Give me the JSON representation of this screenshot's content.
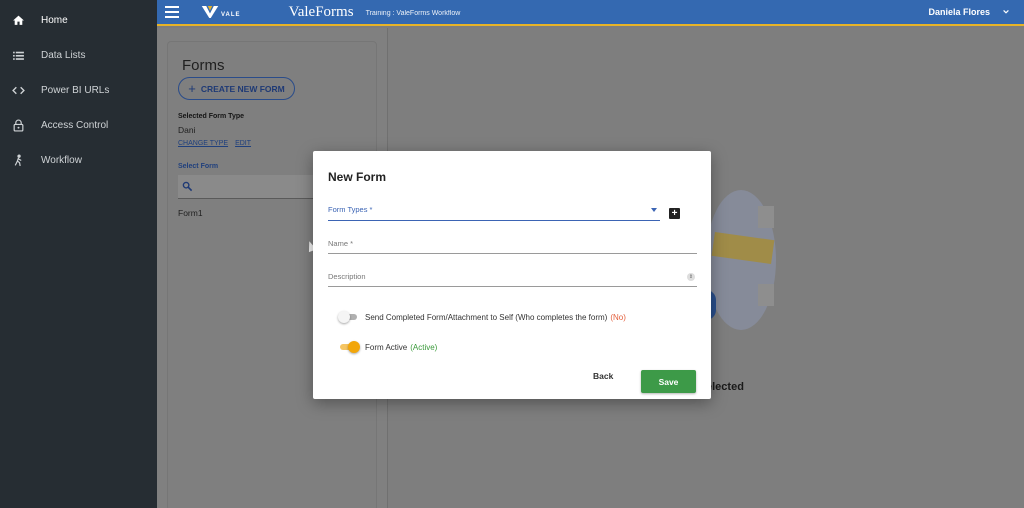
{
  "sidebar": {
    "items": [
      {
        "label": "Home",
        "icon": "home-icon"
      },
      {
        "label": "Data Lists",
        "icon": "list-icon"
      },
      {
        "label": "Power BI URLs",
        "icon": "code-icon"
      },
      {
        "label": "Access Control",
        "icon": "lock-icon"
      },
      {
        "label": "Workflow",
        "icon": "workflow-icon"
      }
    ]
  },
  "topbar": {
    "logo_text": "VALE",
    "app_title": "ValeForms",
    "breadcrumb": "Training : ValeForms Workflow",
    "user_name": "Daniela Flores"
  },
  "forms_panel": {
    "title": "Forms",
    "create_label": "CREATE NEW FORM",
    "selected_type_label": "Selected Form Type",
    "selected_type_value": "Dani",
    "change_type_link": "CHANGE TYPE",
    "edit_link": "EDIT",
    "select_form_label": "Select Form",
    "forms": [
      "Form1"
    ]
  },
  "right_panel": {
    "empty_text": "elected"
  },
  "modal": {
    "title": "New Form",
    "form_types_label": "Form Types *",
    "name_label": "Name *",
    "description_label": "Description",
    "toggle_send": {
      "label": "Send Completed Form/Attachment to Self (Who completes the form)",
      "status": "(No)"
    },
    "toggle_active": {
      "label": "Form Active",
      "status": "(Active)"
    },
    "back_label": "Back",
    "save_label": "Save"
  },
  "colors": {
    "topbar": "#3469b1",
    "accent": "#e7b327",
    "sidebar": "#262d33",
    "save": "#3d9a48",
    "toggle_on": "#f2a60a"
  }
}
